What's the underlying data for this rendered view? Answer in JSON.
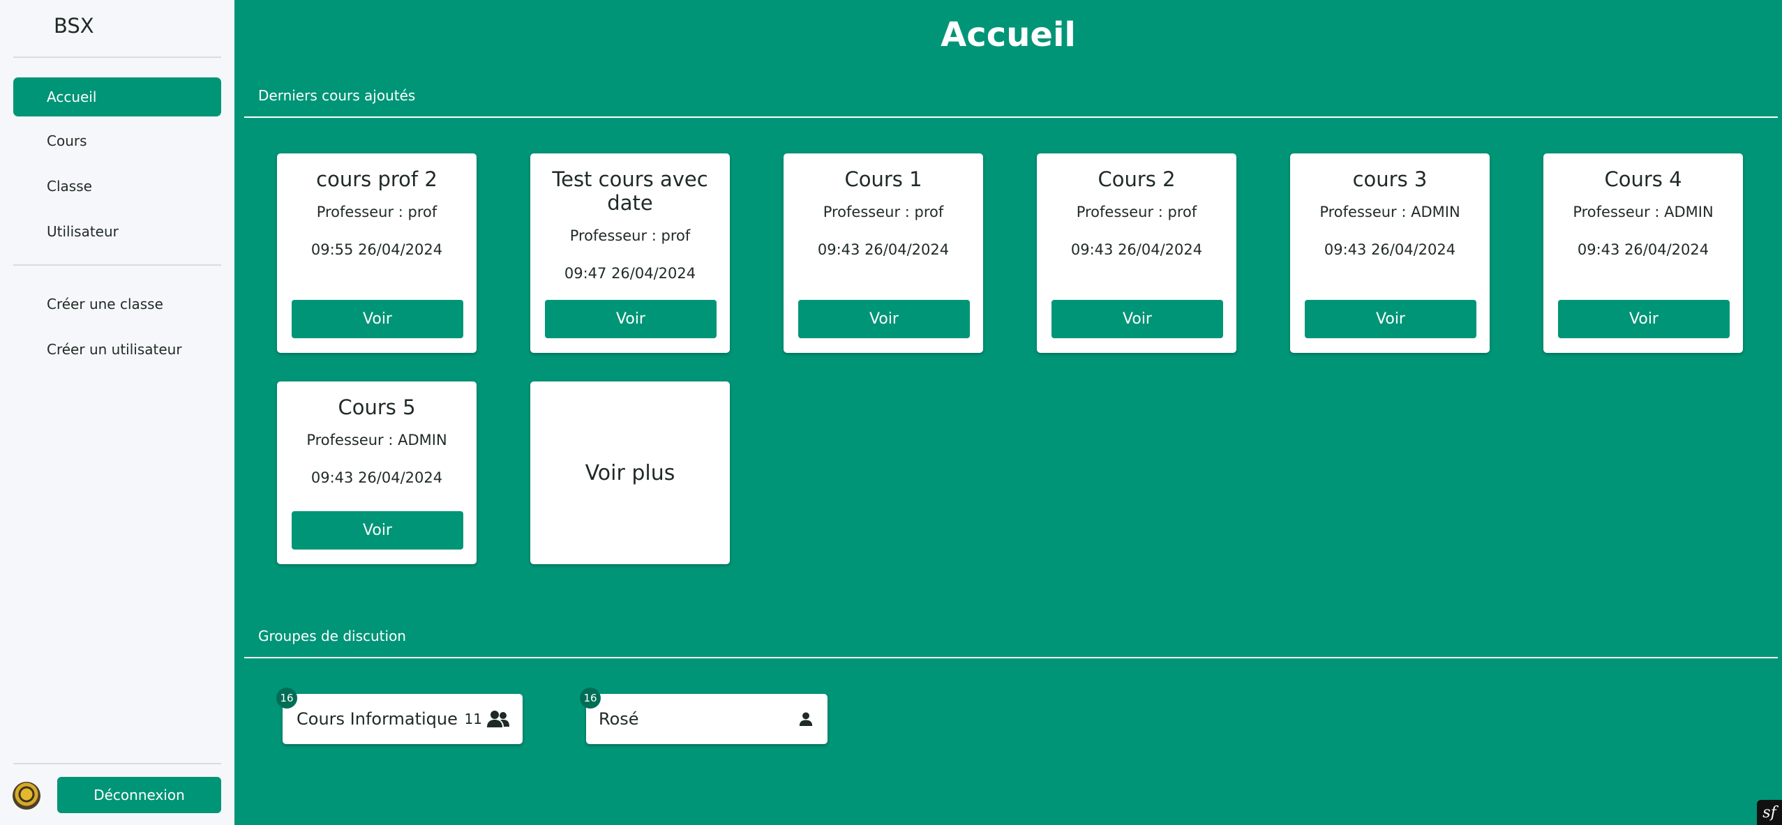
{
  "sidebar": {
    "brand": "BSX",
    "nav": [
      {
        "label": "Accueil",
        "active": true
      },
      {
        "label": "Cours",
        "active": false
      },
      {
        "label": "Classe",
        "active": false
      },
      {
        "label": "Utilisateur",
        "active": false
      }
    ],
    "actions": [
      {
        "label": "Créer une classe"
      },
      {
        "label": "Créer un utilisateur"
      }
    ],
    "logout_label": "Déconnexion"
  },
  "main": {
    "title": "Accueil",
    "courses_section": "Derniers cours ajoutés",
    "courses": [
      {
        "title": "cours prof 2",
        "teacher": "Professeur : prof",
        "datetime": "09:55 26/04/2024",
        "button": "Voir"
      },
      {
        "title": "Test cours avec date",
        "teacher": "Professeur : prof",
        "datetime": "09:47 26/04/2024",
        "button": "Voir"
      },
      {
        "title": "Cours 1",
        "teacher": "Professeur : prof",
        "datetime": "09:43 26/04/2024",
        "button": "Voir"
      },
      {
        "title": "Cours 2",
        "teacher": "Professeur : prof",
        "datetime": "09:43 26/04/2024",
        "button": "Voir"
      },
      {
        "title": "cours 3",
        "teacher": "Professeur : ADMIN",
        "datetime": "09:43 26/04/2024",
        "button": "Voir"
      },
      {
        "title": "Cours 4",
        "teacher": "Professeur : ADMIN",
        "datetime": "09:43 26/04/2024",
        "button": "Voir"
      },
      {
        "title": "Cours 5",
        "teacher": "Professeur : ADMIN",
        "datetime": "09:43 26/04/2024",
        "button": "Voir"
      }
    ],
    "more_label": "Voir plus",
    "groups_section": "Groupes de discution",
    "groups": [
      {
        "name": "Cours Informatique",
        "badge": "16",
        "members": "11",
        "icon": "users-icon"
      },
      {
        "name": "Rosé",
        "badge": "16",
        "members": "",
        "icon": "user-icon"
      }
    ]
  },
  "colors": {
    "accent": "#009577",
    "badge": "#006d57",
    "sidebar_bg": "#f6f7fb"
  }
}
